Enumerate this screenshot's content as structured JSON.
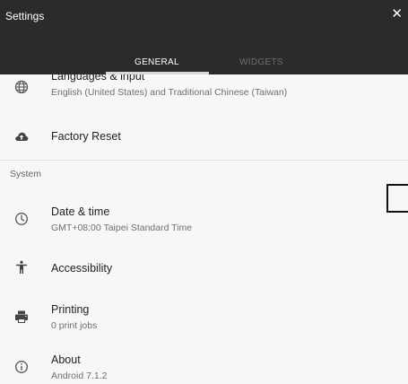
{
  "header": {
    "title": "Settings",
    "close_icon": "close-icon"
  },
  "tabs": [
    {
      "label": "GENERAL",
      "selected": true
    },
    {
      "label": "WIDGETS",
      "selected": false
    }
  ],
  "items": {
    "languages": {
      "label": "Languages & input",
      "sub": "English (United States) and Traditional Chinese (Taiwan)",
      "icon": "globe-icon"
    },
    "factory_reset": {
      "label": "Factory Reset",
      "icon": "cloud-upload-icon"
    },
    "section_system": "System",
    "date_time": {
      "label": "Date & time",
      "sub": "GMT+08:00 Taipei Standard Time",
      "icon": "clock-icon"
    },
    "accessibility": {
      "label": "Accessibility",
      "icon": "accessibility-icon"
    },
    "printing": {
      "label": "Printing",
      "sub": "0 print jobs",
      "icon": "printer-icon"
    },
    "about": {
      "label": "About",
      "sub": "Android 7.1.2",
      "icon": "info-icon"
    }
  },
  "colors": {
    "header_bg": "#2b2b2b",
    "body_bg": "#f7f7f7"
  }
}
